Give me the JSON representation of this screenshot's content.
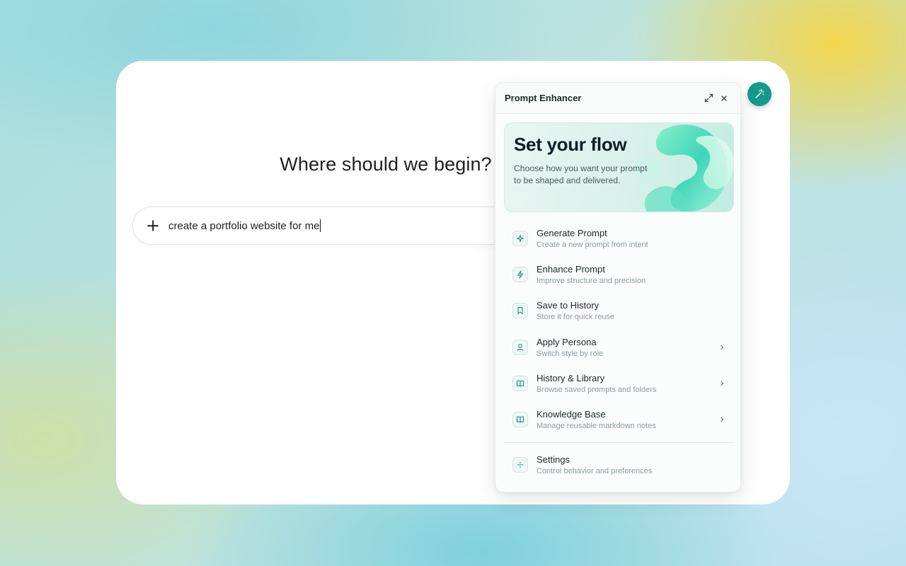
{
  "main": {
    "heading": "Where should we begin?",
    "composer_text": "create a portfolio website for me"
  },
  "panel": {
    "title": "Prompt Enhancer",
    "hero": {
      "title": "Set your flow",
      "description": "Choose how you want your prompt to be shaped and delivered."
    },
    "items": [
      {
        "label": "Generate Prompt",
        "sub": "Create a new prompt from intent",
        "icon": "sparkle-icon",
        "has_chevron": false
      },
      {
        "label": "Enhance Prompt",
        "sub": "Improve structure and precision",
        "icon": "lightning-icon",
        "has_chevron": false
      },
      {
        "label": "Save to History",
        "sub": "Store it for quick reuse",
        "icon": "bookmark-icon",
        "has_chevron": false
      },
      {
        "label": "Apply Persona",
        "sub": "Switch style by role",
        "icon": "person-icon",
        "has_chevron": true
      },
      {
        "label": "History & Library",
        "sub": "Browse saved prompts and folders",
        "icon": "book-icon",
        "has_chevron": true
      },
      {
        "label": "Knowledge Base",
        "sub": "Manage reusable markdown notes",
        "icon": "book-icon",
        "has_chevron": true
      }
    ],
    "settings": {
      "label": "Settings",
      "sub": "Control behavior and preferences",
      "icon": "divide-icon"
    }
  },
  "colors": {
    "accent": "#149a89",
    "icon_stroke": "#1f8f80"
  }
}
